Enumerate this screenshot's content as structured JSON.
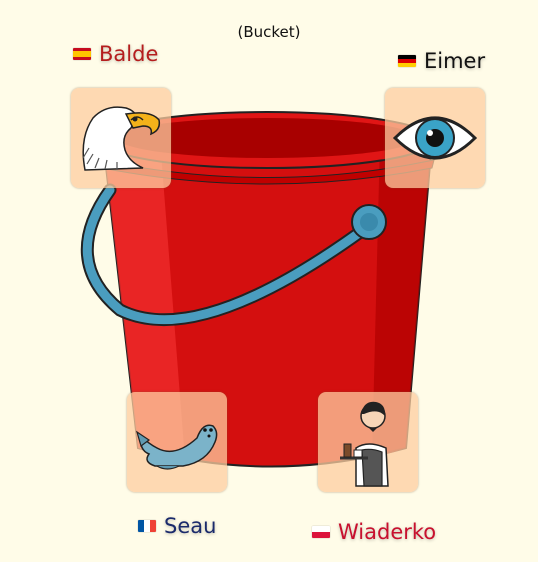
{
  "caption": "(Bucket)",
  "words": [
    {
      "lang": "es",
      "text": "Balde",
      "color": "#b51d1d"
    },
    {
      "lang": "de",
      "text": "Eimer",
      "color": "#111111"
    },
    {
      "lang": "fr",
      "text": "Seau",
      "color": "#1a2a6b"
    },
    {
      "lang": "pl",
      "text": "Wiaderko",
      "color": "#c8102e"
    }
  ],
  "pictograms": [
    "eagle-icon",
    "eye-icon",
    "seal-icon",
    "waiter-icon"
  ],
  "colors": {
    "background": "#fffce8",
    "bucket": "#d40f0f",
    "handle": "#4a9dbf",
    "tile": "#fdcda0"
  }
}
